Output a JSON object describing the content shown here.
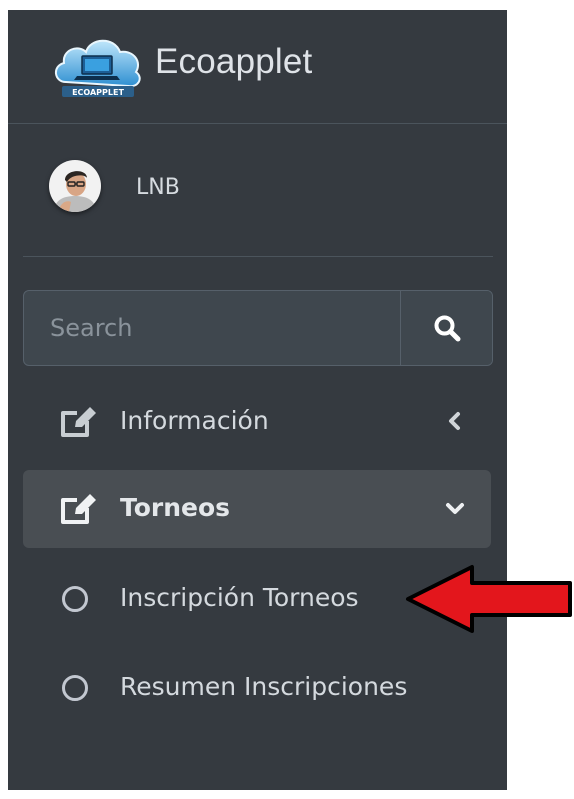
{
  "brand": {
    "name": "Ecoapplet",
    "logo_text": "ECOAPPLET",
    "logo_icon": "cloud-laptop-logo"
  },
  "user": {
    "name": "LNB",
    "avatar_icon": "user-avatar-photo"
  },
  "search": {
    "placeholder": "Search",
    "value": "",
    "button_icon": "search-icon"
  },
  "nav": {
    "items": [
      {
        "label": "Información",
        "icon": "edit-icon",
        "arrow_icon": "chevron-left-icon",
        "active": false
      },
      {
        "label": "Torneos",
        "icon": "edit-icon",
        "arrow_icon": "chevron-down-icon",
        "active": true,
        "children": [
          {
            "label": "Inscripción Torneos",
            "icon": "circle-outline-icon"
          },
          {
            "label": "Resumen Inscripciones",
            "icon": "circle-outline-icon"
          }
        ]
      }
    ]
  },
  "annotation": {
    "icon": "red-arrow-pointer",
    "color": "#e3161c"
  },
  "colors": {
    "sidebar_bg": "#353a40",
    "active_item_bg": "#494e53",
    "text": "#c2c7d0"
  }
}
